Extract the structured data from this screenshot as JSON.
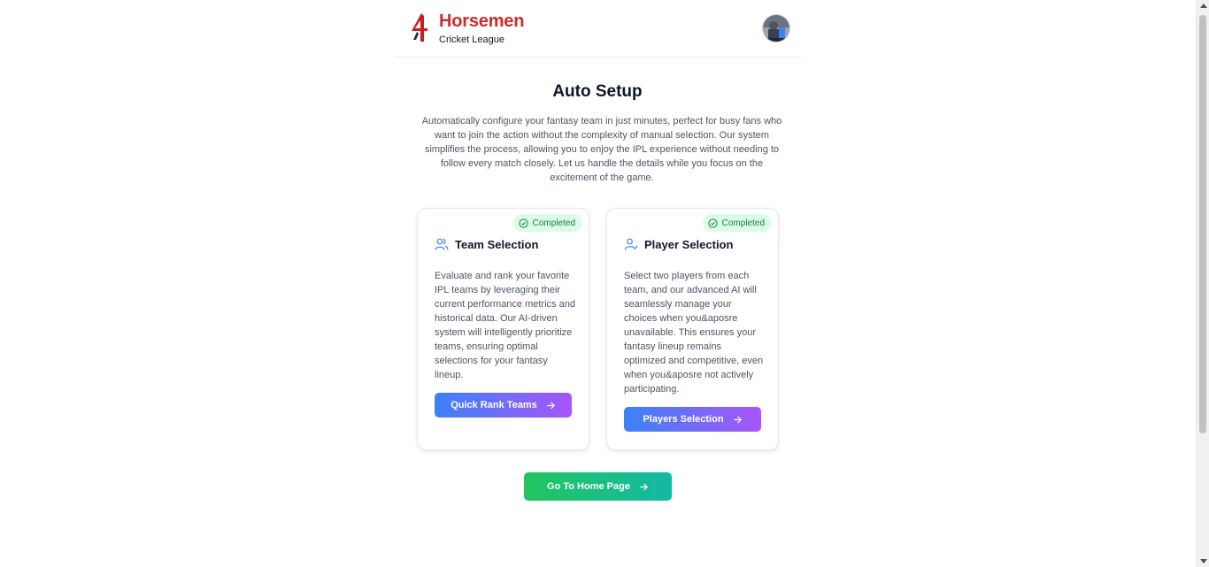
{
  "header": {
    "brand_title": "Horsemen",
    "brand_subtitle": "Cricket League",
    "logo_icon": "horsemen-logo",
    "avatar_icon": "user-avatar"
  },
  "main": {
    "title": "Auto Setup",
    "description": "Automatically configure your fantasy team in just minutes, perfect for busy fans who want to join the action without the complexity of manual selection. Our system simplifies the process, allowing you to enjoy the IPL experience without needing to follow every match closely. Let us handle the details while you focus on the excitement of the game."
  },
  "cards": [
    {
      "badge": "Completed",
      "icon": "users-icon",
      "title": "Team Selection",
      "text": "Evaluate and rank your favorite IPL teams by leveraging their current performance metrics and historical data. Our AI-driven system will intelligently prioritize teams, ensuring optimal selections for your fantasy lineup.",
      "button": "Quick Rank Teams"
    },
    {
      "badge": "Completed",
      "icon": "user-check-icon",
      "title": "Player Selection",
      "text": "Select two players from each team, and our advanced AI will seamlessly manage your choices when you&aposre unavailable. This ensures your fantasy lineup remains optimized and competitive, even when you&aposre not actively participating.",
      "button": "Players Selection"
    }
  ],
  "home_button": "Go To Home Page",
  "colors": {
    "brand_red": "#d12a2a",
    "badge_bg": "#dcfce7",
    "badge_text": "#15803d",
    "gradient_blue": "#3b82f6",
    "gradient_purple": "#a855f7",
    "gradient_green": "#22c55e",
    "gradient_teal": "#14b8a6"
  }
}
